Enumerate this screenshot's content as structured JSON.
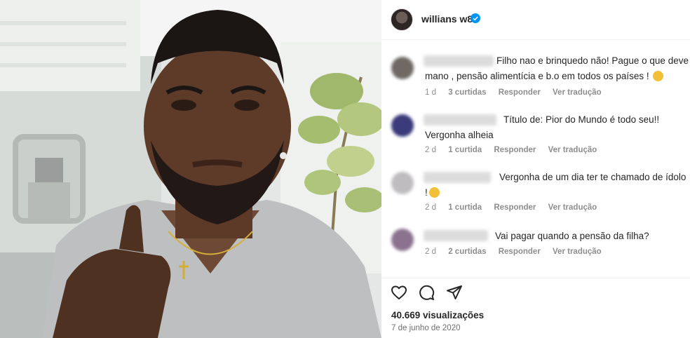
{
  "post": {
    "username": "willians w8",
    "views": "40.669 visualizações",
    "date": "7 de junho de 2020"
  },
  "comments": [
    {
      "text_lines": [
        "Filho nao e brinquedo não! Pague o que deve",
        "mano , pensão alimentícia e b.o em todos os países !"
      ],
      "time": "1 d",
      "likes": "3 curtidas",
      "reply": "Responder",
      "translate": "Ver tradução",
      "emoji": "clapping-hands-emoji"
    },
    {
      "text_lines": [
        "Título de: Pior do Mundo é todo seu!!",
        "Vergonha alheia"
      ],
      "time": "2 d",
      "likes": "1 curtida",
      "reply": "Responder",
      "translate": "Ver tradução"
    },
    {
      "text_lines": [
        "Vergonha de um dia ter te chamado de ídolo",
        "!"
      ],
      "time": "2 d",
      "likes": "1 curtida",
      "reply": "Responder",
      "translate": "Ver tradução",
      "emoji": "persevering-face-emoji"
    },
    {
      "text_lines": [
        "Vai pagar quando a pensão da filha?"
      ],
      "time": "2 d",
      "likes": "2 curtidas",
      "reply": "Responder",
      "translate": "Ver tradução"
    }
  ],
  "icons": {
    "like": "heart-icon",
    "comment": "comment-bubble-icon",
    "share": "paper-plane-icon",
    "verified": "verified-badge-icon"
  },
  "colors": {
    "verified": "#0095f6",
    "meta_text": "#8e8e8e",
    "border": "#efefef"
  }
}
